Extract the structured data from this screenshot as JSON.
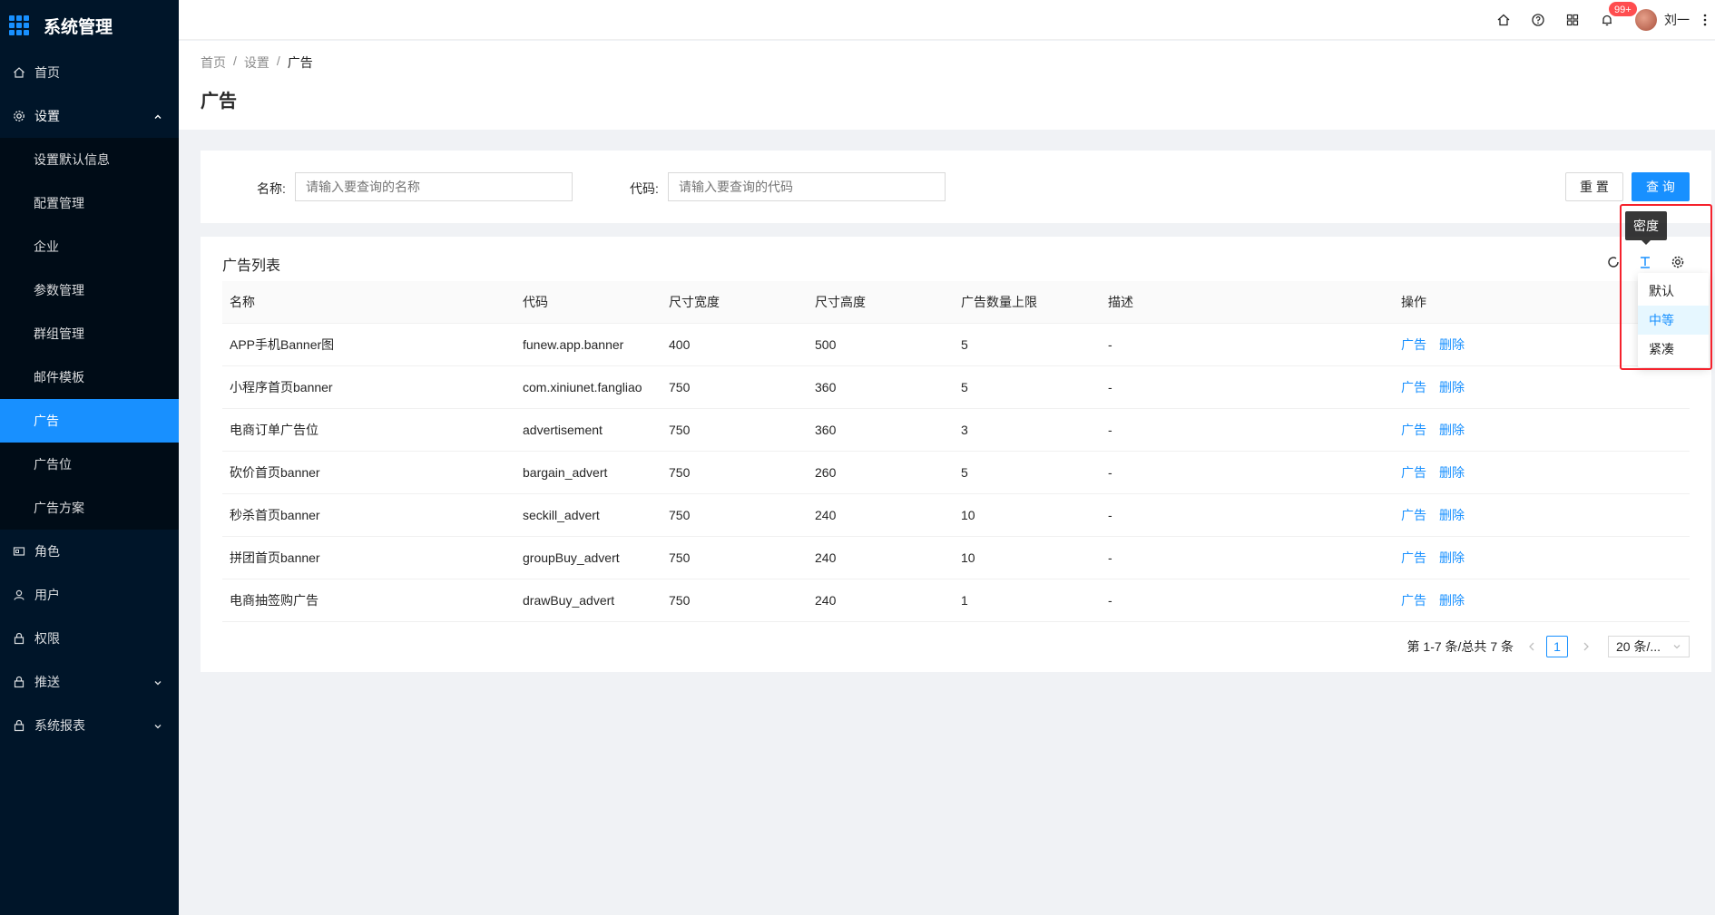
{
  "app": {
    "title": "系统管理"
  },
  "colors": {
    "accent": "#1890ff",
    "sidebar_bg": "#001529",
    "highlight": "#f5222d",
    "badge": "#ff4d4f"
  },
  "sidebar": {
    "items": [
      {
        "label": "首页",
        "icon": "home-icon"
      },
      {
        "label": "设置",
        "icon": "gear-icon",
        "open": true
      },
      {
        "label": "角色",
        "icon": "id-card-icon"
      },
      {
        "label": "用户",
        "icon": "user-icon"
      },
      {
        "label": "权限",
        "icon": "lock-icon"
      },
      {
        "label": "推送",
        "icon": "lock-icon",
        "expandable": true
      },
      {
        "label": "系统报表",
        "icon": "lock-icon",
        "expandable": true
      }
    ],
    "submenu": [
      {
        "label": "设置默认信息"
      },
      {
        "label": "配置管理"
      },
      {
        "label": "企业"
      },
      {
        "label": "参数管理"
      },
      {
        "label": "群组管理"
      },
      {
        "label": "邮件模板"
      },
      {
        "label": "广告",
        "active": true
      },
      {
        "label": "广告位"
      },
      {
        "label": "广告方案"
      }
    ]
  },
  "header": {
    "icons": [
      "home-icon",
      "help-icon",
      "apps-icon",
      "bell-icon"
    ],
    "badge": "99+",
    "user_name": "刘一"
  },
  "breadcrumb": [
    "首页",
    "设置",
    "广告"
  ],
  "breadcrumb_sep": "/",
  "page_title": "广告",
  "search": {
    "name_label": "名称:",
    "name_placeholder": "请输入要查询的名称",
    "code_label": "代码:",
    "code_placeholder": "请输入要查询的代码",
    "reset": "重 置",
    "query": "查 询"
  },
  "table": {
    "title": "广告列表",
    "columns": [
      "名称",
      "代码",
      "尺寸宽度",
      "尺寸高度",
      "广告数量上限",
      "描述",
      "操作"
    ],
    "rows": [
      [
        "APP手机Banner图",
        "funew.app.banner",
        "400",
        "500",
        "5",
        "-"
      ],
      [
        "小程序首页banner",
        "com.xiniunet.fangliao",
        "750",
        "360",
        "5",
        "-"
      ],
      [
        "电商订单广告位",
        "advertisement",
        "750",
        "360",
        "3",
        "-"
      ],
      [
        "砍价首页banner",
        "bargain_advert",
        "750",
        "260",
        "5",
        "-"
      ],
      [
        "秒杀首页banner",
        "seckill_advert",
        "750",
        "240",
        "10",
        "-"
      ],
      [
        "拼团首页banner",
        "groupBuy_advert",
        "750",
        "240",
        "10",
        "-"
      ],
      [
        "电商抽签购广告",
        "drawBuy_advert",
        "750",
        "240",
        "1",
        "-"
      ]
    ],
    "action_edit": "广告",
    "action_delete": "删除"
  },
  "pagination": {
    "summary": "第 1-7 条/总共 7 条",
    "current": "1",
    "page_size": "20 条/..."
  },
  "density": {
    "tooltip": "密度",
    "options": [
      {
        "label": "默认"
      },
      {
        "label": "中等",
        "selected": true
      },
      {
        "label": "紧凑"
      }
    ]
  }
}
